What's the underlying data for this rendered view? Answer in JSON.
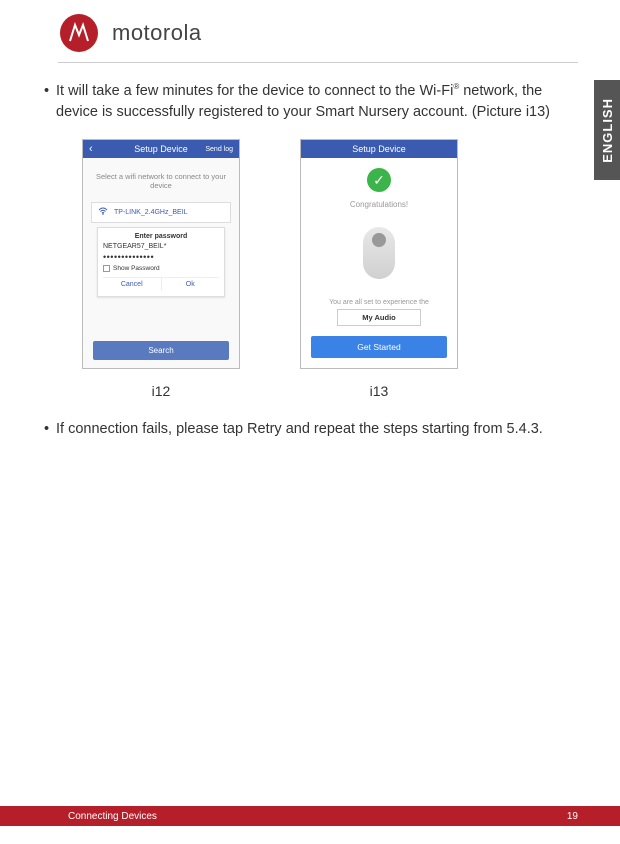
{
  "brand": "motorola",
  "side_tab": "ENGLISH",
  "bullets": {
    "b1_a": "It will take a few minutes for the device to connect to the Wi-Fi",
    "b1_sup": "®",
    "b1_b": " network, the device is successfully registered to your Smart Nursery account. (Picture i13)",
    "b2": "If connection fails, please tap Retry and repeat the steps starting from 5.4.3."
  },
  "captions": {
    "i12": "i12",
    "i13": "i13"
  },
  "phone1": {
    "title": "Setup Device",
    "back": "‹",
    "send_log": "Send log",
    "select_text": "Select a wifi network to connect to your device",
    "wifi_name": "TP-LINK_2.4GHz_BEIL",
    "pwd_title": "Enter password",
    "pwd_net": "NETGEAR57_BEIL*",
    "pwd_dots": "••••••••••••••",
    "show_pwd": "Show Password",
    "cancel": "Cancel",
    "ok": "Ok",
    "search": "Search"
  },
  "phone2": {
    "title": "Setup Device",
    "congrats": "Congratulations!",
    "experience": "You are all set to experience the",
    "myaudio": "My Audio",
    "getstarted": "Get Started"
  },
  "footer": {
    "section": "Connecting Devices",
    "page": "19"
  }
}
